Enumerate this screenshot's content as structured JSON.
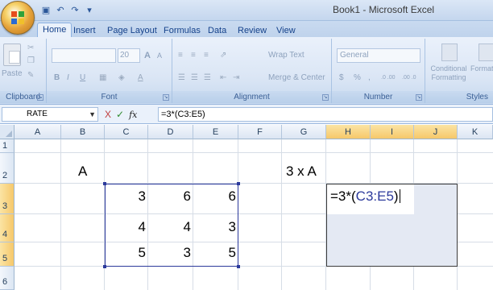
{
  "window": {
    "title": "Book1 - Microsoft Excel"
  },
  "quick_access": {
    "icons": [
      "save-icon",
      "undo-icon",
      "redo-icon",
      "customize-icon"
    ]
  },
  "tabs": [
    "Home",
    "Insert",
    "Page Layout",
    "Formulas",
    "Data",
    "Review",
    "View"
  ],
  "active_tab": "Home",
  "ribbon": {
    "clipboard": {
      "label": "Clipboard",
      "paste_label": "Paste"
    },
    "font": {
      "label": "Font",
      "font_size": "20",
      "bold": "B",
      "italic": "I",
      "underline": "U",
      "grow": "A",
      "shrink": "A"
    },
    "alignment": {
      "label": "Alignment",
      "wrap_text": "Wrap Text",
      "merge_center": "Merge & Center"
    },
    "number": {
      "label": "Number",
      "format": "General",
      "currency": "$",
      "percent": "%",
      "comma": ",",
      "inc_decimal": ".0 .00",
      "dec_decimal": ".00 .0"
    },
    "styles": {
      "label": "Styles",
      "conditional_formatting": "Conditional Formatting",
      "format_as_table": "Format Table"
    }
  },
  "formula_bar": {
    "name_box": "RATE",
    "cancel": "X",
    "enter": "✓",
    "fx": "fx",
    "formula": "=3*(C3:E5)"
  },
  "columns": [
    "A",
    "B",
    "C",
    "D",
    "E",
    "F",
    "G",
    "H",
    "I",
    "J",
    "K"
  ],
  "rows": [
    "1",
    "2",
    "3",
    "4",
    "5",
    "6"
  ],
  "cells": {
    "B2": "A",
    "G2": "3 x A",
    "matrix": [
      [
        "3",
        "6",
        "6"
      ],
      [
        "4",
        "4",
        "3"
      ],
      [
        "5",
        "3",
        "5"
      ]
    ]
  },
  "edit": {
    "prefix": "=3*(",
    "ref": "C3:E5",
    "suffix": ")"
  },
  "colors": {
    "ref_blue": "#2c3a9c",
    "header_selected": "#f6c86a"
  }
}
